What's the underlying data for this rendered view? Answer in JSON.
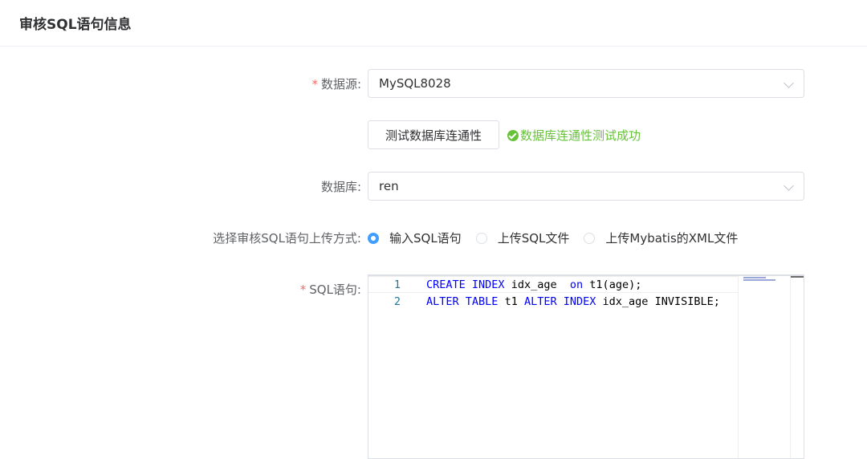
{
  "header": {
    "title": "审核SQL语句信息"
  },
  "form": {
    "datasource": {
      "required_mark": "*",
      "label": "数据源:",
      "value": "MySQL8028"
    },
    "test_button_label": "测试数据库连通性",
    "test_result": "数据库连通性测试成功",
    "database": {
      "label": "数据库:",
      "value": "ren"
    },
    "upload_mode": {
      "label": "选择审核SQL语句上传方式:",
      "options": [
        "输入SQL语句",
        "上传SQL文件",
        "上传Mybatis的XML文件"
      ],
      "selected": "输入SQL语句"
    },
    "sql": {
      "required_mark": "*",
      "label": "SQL语句:",
      "lines": [
        {
          "number": "1",
          "text": "CREATE INDEX idx_age  on t1(age);"
        },
        {
          "number": "2",
          "text": "ALTER TABLE t1 ALTER INDEX idx_age INVISIBLE;"
        }
      ]
    }
  },
  "colors": {
    "accent": "#409eff",
    "success": "#67c23a",
    "required": "#f56c6c",
    "keyword": "#0000ff"
  }
}
